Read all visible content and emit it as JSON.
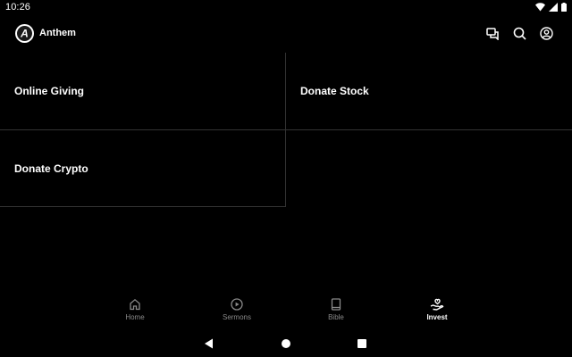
{
  "status_bar": {
    "time": "10:26",
    "icons": [
      "wifi-icon",
      "signal-icon",
      "battery-icon"
    ]
  },
  "app_bar": {
    "title": "Anthem",
    "logo_letter": "A",
    "actions": [
      "chat-icon",
      "search-icon",
      "account-icon"
    ]
  },
  "tiles": [
    {
      "label": "Online Giving"
    },
    {
      "label": "Donate Stock"
    },
    {
      "label": "Donate Crypto"
    }
  ],
  "bottom_nav": {
    "items": [
      {
        "label": "Home",
        "icon": "home-icon",
        "active": false
      },
      {
        "label": "Sermons",
        "icon": "play-circle-icon",
        "active": false
      },
      {
        "label": "Bible",
        "icon": "book-icon",
        "active": false
      },
      {
        "label": "Invest",
        "icon": "hand-heart-icon",
        "active": true
      }
    ]
  },
  "system_nav": [
    "back-icon",
    "home-circle-icon",
    "recents-icon"
  ],
  "colors": {
    "background": "#000000",
    "text": "#ffffff",
    "inactive": "#8a8a8a",
    "divider": "#333333"
  }
}
